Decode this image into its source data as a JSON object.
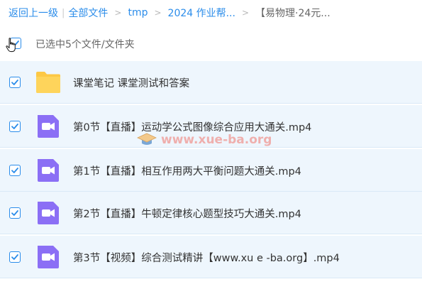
{
  "breadcrumb": {
    "back_label": "返回上一级",
    "items": [
      {
        "label": "全部文件"
      },
      {
        "label": "tmp"
      },
      {
        "label": "2024 作业帮..."
      },
      {
        "label": "【易物理·24元..."
      }
    ]
  },
  "selection": {
    "text": "已选中5个文件/文件夹",
    "checked": true
  },
  "files": [
    {
      "name": "课堂笔记 课堂测试和答案",
      "type": "folder",
      "checked": true
    },
    {
      "name": "第0节【直播】运动学公式图像综合应用大通关.mp4",
      "type": "video",
      "checked": true
    },
    {
      "name": "第1节【直播】相互作用两大平衡问题大通关.mp4",
      "type": "video",
      "checked": true
    },
    {
      "name": "第2节【直播】牛顿定律核心题型技巧大通关.mp4",
      "type": "video",
      "checked": true
    },
    {
      "name": "第3节【视频】综合测试精讲【www.xu e -ba.org】.mp4",
      "type": "video",
      "checked": true
    }
  ],
  "watermark": {
    "text": "www.xue-ba.org"
  },
  "colors": {
    "accent": "#2a8cea",
    "row_selected_bg": "#eef6fd",
    "folder": "#fdc845",
    "video": "#8b6ff5"
  },
  "icons": {
    "checkbox": "checkmark-icon",
    "folder": "folder-icon",
    "video": "video-camera-icon",
    "cursor": "hand-pointer-icon"
  }
}
